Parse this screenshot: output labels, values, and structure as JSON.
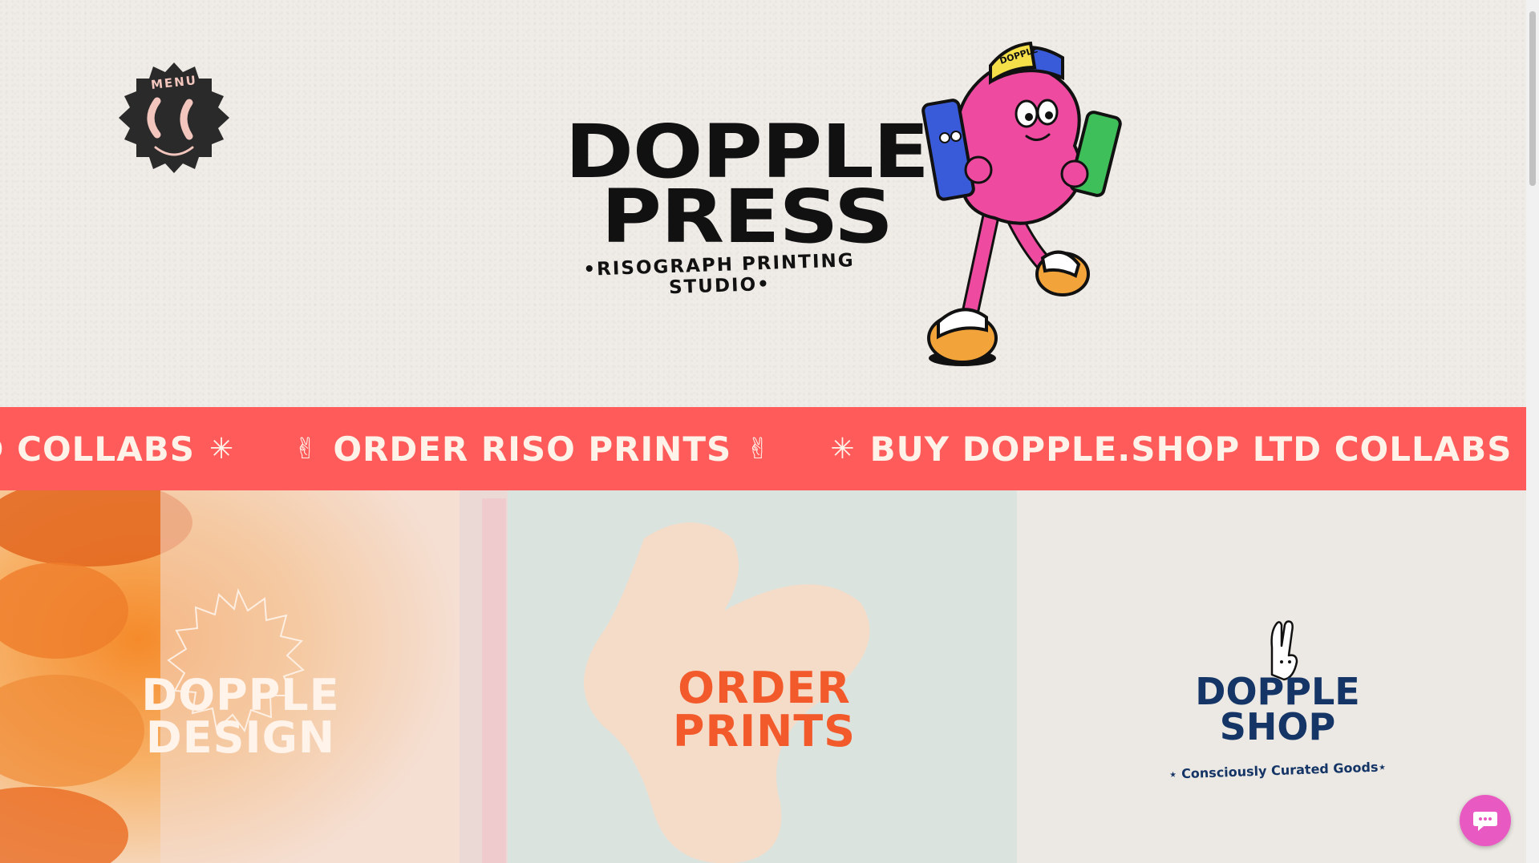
{
  "header": {
    "menu_label": "MENU",
    "logo_line1": "DOPPLE",
    "logo_line2": "PRESS",
    "tagline": "•RISOGRAPH PRINTING STUDIO•",
    "mascot_cap_text": "DOPPLE"
  },
  "ticker": {
    "items": [
      {
        "text": "TD COLLABS",
        "glyph": "✳"
      },
      {
        "text": "ORDER RISO PRINTS",
        "glyph": "✌"
      },
      {
        "text": "BUY DOPPLE.SHOP LTD COLLABS",
        "glyph": "✳"
      }
    ],
    "lead_glyph": "✌",
    "mid_glyph": "✳"
  },
  "tiles": {
    "design": {
      "line1": "DOPPLE",
      "line2": "DESIGN"
    },
    "order": {
      "line1": "ORDER",
      "line2": "PRINTS"
    },
    "shop": {
      "line1": "DOPPLE",
      "line2": "SHOP",
      "tagline": "⋆ Consciously Curated Goods⋆"
    }
  },
  "colors": {
    "background": "#efebe6",
    "ticker": "#ff5b5b",
    "order_accent": "#f25a2c",
    "shop_navy": "#143566",
    "chat": "#e85ac2",
    "mascot_pink": "#ee4aa0"
  },
  "icons": {
    "menu": "smiling-moon-badge-icon",
    "chat": "chat-bubble-icon",
    "peace": "peace-hand-icon",
    "asterisk": "asterisk-icon"
  }
}
